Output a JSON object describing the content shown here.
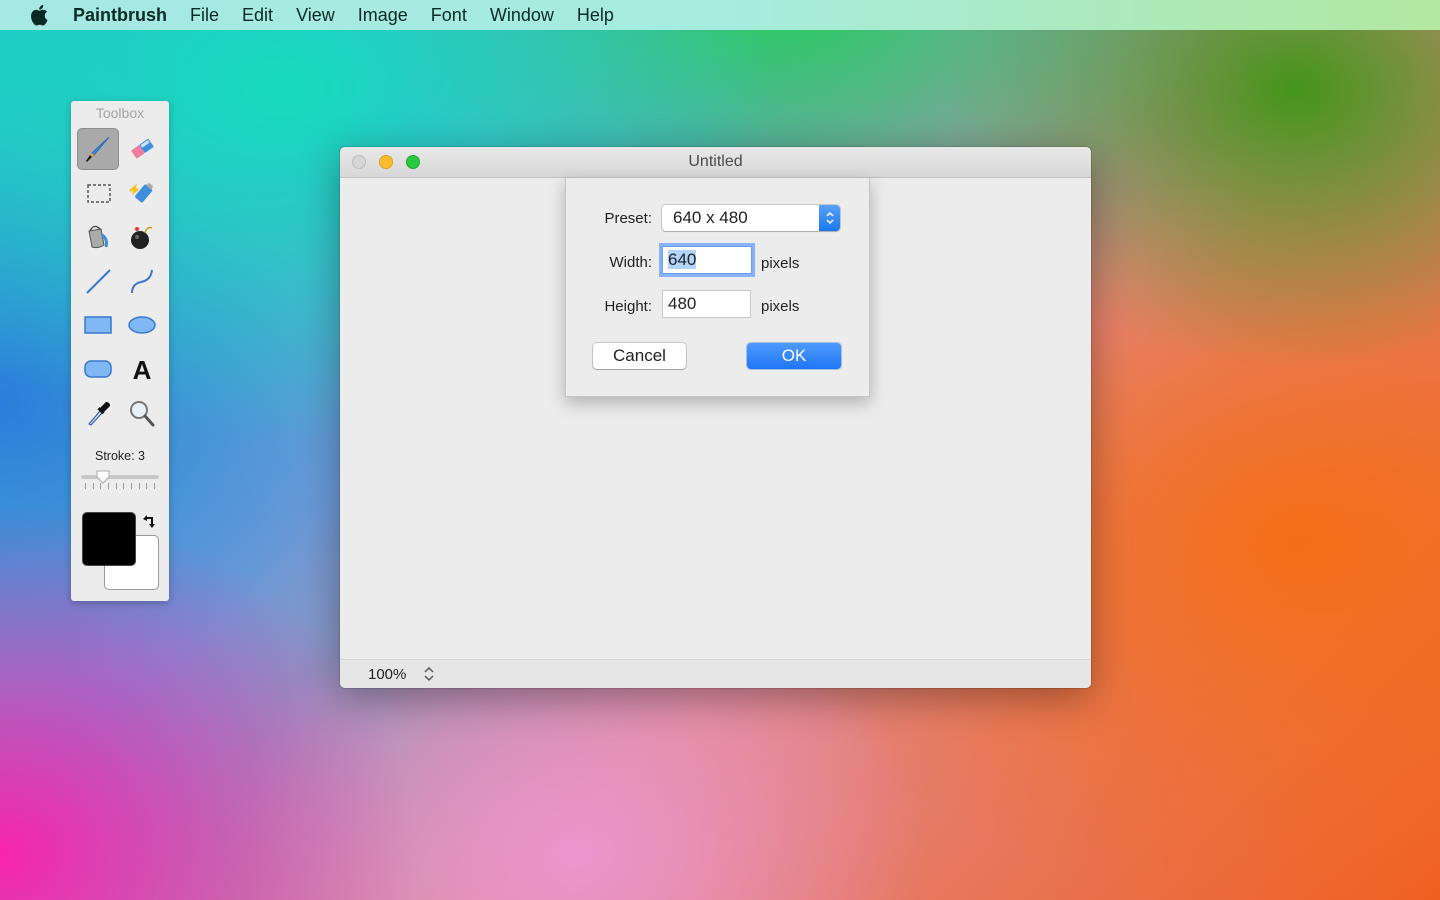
{
  "menubar": {
    "apple_icon": "apple-logo",
    "app_name": "Paintbrush",
    "items": [
      "File",
      "Edit",
      "View",
      "Image",
      "Font",
      "Window",
      "Help"
    ]
  },
  "toolbox": {
    "title": "Toolbox",
    "tools": [
      {
        "name": "paintbrush",
        "icon": "paintbrush-icon",
        "selected": true
      },
      {
        "name": "eraser",
        "icon": "eraser-icon",
        "selected": false
      },
      {
        "name": "selection",
        "icon": "selection-rect-icon",
        "selected": false
      },
      {
        "name": "spray",
        "icon": "spray-can-icon",
        "selected": false
      },
      {
        "name": "fill",
        "icon": "paint-bucket-icon",
        "selected": false
      },
      {
        "name": "bomb",
        "icon": "bomb-icon",
        "selected": false
      },
      {
        "name": "line",
        "icon": "line-icon",
        "selected": false
      },
      {
        "name": "curve",
        "icon": "curve-icon",
        "selected": false
      },
      {
        "name": "rectangle",
        "icon": "rectangle-icon",
        "selected": false
      },
      {
        "name": "ellipse",
        "icon": "ellipse-icon",
        "selected": false
      },
      {
        "name": "rounded-rectangle",
        "icon": "rounded-rect-icon",
        "selected": false
      },
      {
        "name": "text",
        "icon": "text-icon",
        "selected": false
      },
      {
        "name": "eyedropper",
        "icon": "eyedropper-icon",
        "selected": false
      },
      {
        "name": "zoom",
        "icon": "magnifier-icon",
        "selected": false
      }
    ],
    "stroke_label": "Stroke: 3",
    "stroke_value": 3,
    "foreground_color": "#000000",
    "background_color": "#ffffff"
  },
  "window": {
    "title": "Untitled",
    "zoom_level": "100%"
  },
  "dialog": {
    "preset_label": "Preset:",
    "preset_value": "640 x 480",
    "width_label": "Width:",
    "width_value": "640",
    "height_label": "Height:",
    "height_value": "480",
    "unit": "pixels",
    "cancel_label": "Cancel",
    "ok_label": "OK"
  },
  "colors": {
    "accent": "#1f76f5",
    "selection": "#b3d4fc"
  }
}
